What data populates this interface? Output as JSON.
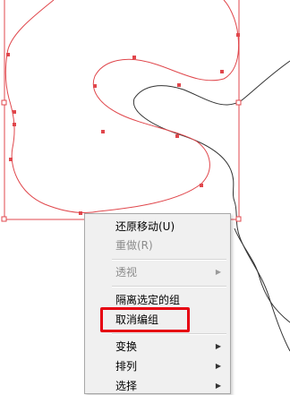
{
  "context_menu": {
    "items": [
      {
        "label": "还原移动(U)",
        "disabled": false
      },
      {
        "label": "重做(R)",
        "disabled": true
      },
      {
        "label": "透视",
        "disabled": true,
        "submenu": true
      },
      {
        "label": "隔离选定的组",
        "disabled": false
      },
      {
        "label": "取消编组",
        "disabled": false
      },
      {
        "label": "变换",
        "disabled": false,
        "submenu": true
      },
      {
        "label": "排列",
        "disabled": false,
        "submenu": true
      },
      {
        "label": "选择",
        "disabled": false,
        "submenu": true
      }
    ],
    "submenu_arrow": "▶"
  },
  "colors": {
    "selection": "#e0474c",
    "path": "#333333",
    "highlight": "#e60012",
    "menu_bg": "#f0f0f0"
  }
}
